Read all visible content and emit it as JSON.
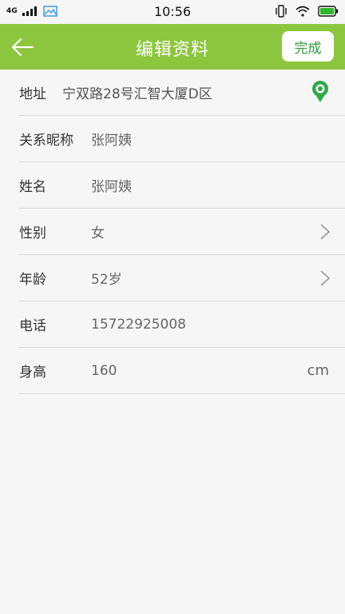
{
  "status_bar": {
    "network": "4G",
    "time": "10:56"
  },
  "header": {
    "title": "编辑资料",
    "done_label": "完成",
    "bg_color": "#8cc63e"
  },
  "form": {
    "address": {
      "label": "地址",
      "value": "宁双路28号汇智大厦D区"
    },
    "nickname": {
      "label": "关系昵称",
      "value": "张阿姨"
    },
    "name": {
      "label": "姓名",
      "value": "张阿姨"
    },
    "gender": {
      "label": "性别",
      "value": "女"
    },
    "age": {
      "label": "年龄",
      "value": "52岁"
    },
    "phone": {
      "label": "电话",
      "value": "15722925008"
    },
    "height": {
      "label": "身高",
      "value": "160",
      "unit": "cm"
    }
  }
}
